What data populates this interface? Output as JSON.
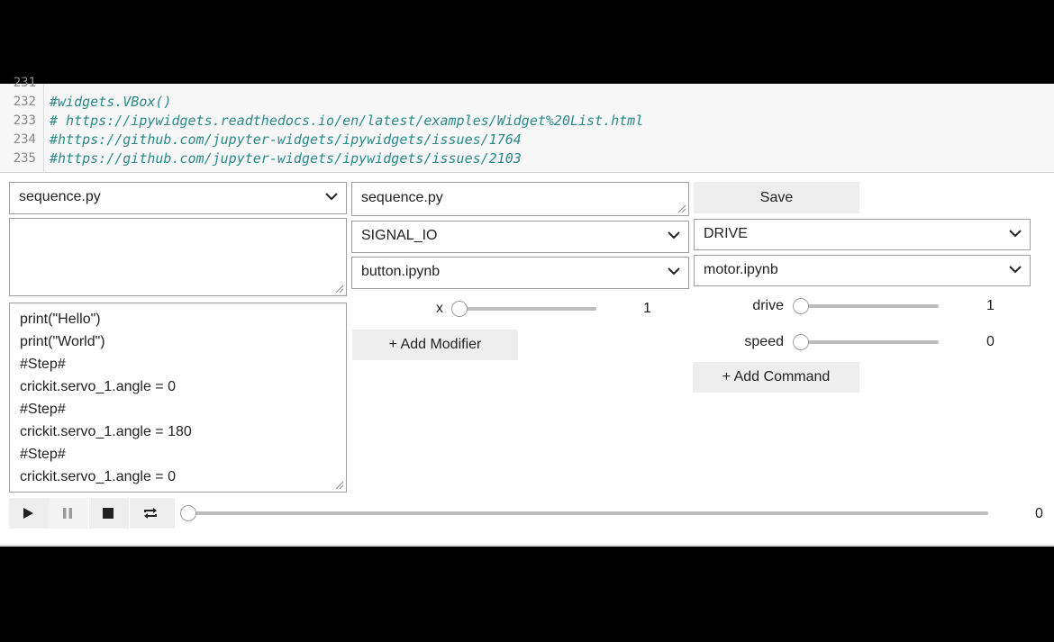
{
  "code": {
    "lines": [
      {
        "num": "231",
        "text": ""
      },
      {
        "num": "232",
        "text": "#widgets.VBox()"
      },
      {
        "num": "233",
        "text": "# https://ipywidgets.readthedocs.io/en/latest/examples/Widget%20List.html"
      },
      {
        "num": "234",
        "text": "#https://github.com/jupyter-widgets/ipywidgets/issues/1764"
      },
      {
        "num": "235",
        "text": "#https://github.com/jupyter-widgets/ipywidgets/issues/2103"
      }
    ]
  },
  "left": {
    "file_select": "sequence.py",
    "notes_area": "",
    "script_lines": [
      "print(\"Hello\")",
      "print(\"World\")",
      "#Step#",
      "crickit.servo_1.angle = 0",
      "#Step#",
      "crickit.servo_1.angle = 180",
      "#Step#",
      "crickit.servo_1.angle = 0"
    ]
  },
  "middle": {
    "filename_input": "sequence.py",
    "signal_select": "SIGNAL_IO",
    "notebook_select": "button.ipynb",
    "x_label": "x",
    "x_value": "1",
    "add_modifier": "+ Add Modifier"
  },
  "right": {
    "save_label": "Save",
    "drive_select": "DRIVE",
    "motor_select": "motor.ipynb",
    "drive_label": "drive",
    "drive_value": "1",
    "speed_label": "speed",
    "speed_value": "0",
    "add_command": "+ Add Command"
  },
  "player": {
    "value": "0",
    "icons": [
      "play-icon",
      "pause-icon",
      "stop-icon",
      "repeat-icon"
    ]
  }
}
